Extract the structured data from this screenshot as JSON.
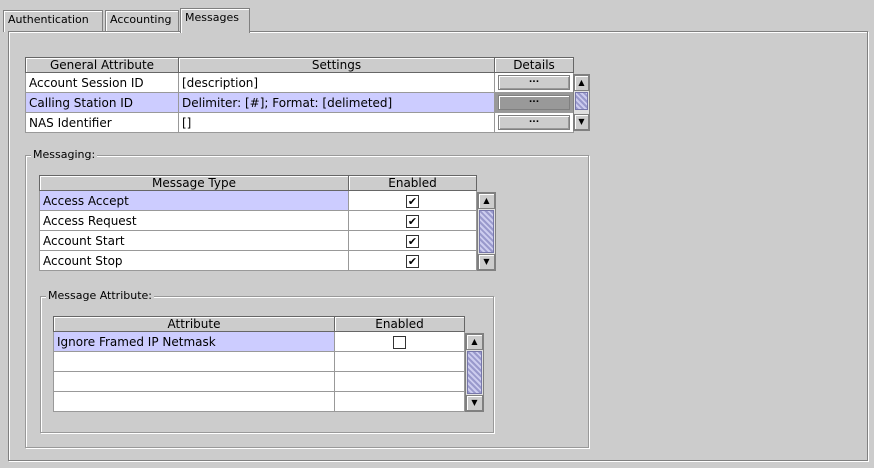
{
  "tabs": [
    "Authentication",
    "Accounting",
    "Messages"
  ],
  "attributes_table": {
    "columns": [
      "General Attribute",
      "Settings",
      "Details"
    ],
    "rows": [
      {
        "attribute": "Account Session ID",
        "settings": "[description]",
        "details": "..."
      },
      {
        "attribute": "Calling Station ID",
        "settings": "Delimiter:  [#]; Format: [delimeted]",
        "details": "..."
      },
      {
        "attribute": "NAS Identifier",
        "settings": "[]",
        "details": "..."
      }
    ]
  },
  "messaging": {
    "legend": "Messaging:",
    "columns": [
      "Message Type",
      "Enabled"
    ],
    "rows": [
      {
        "type": "Access Accept",
        "enabled": "✔"
      },
      {
        "type": "Access Request",
        "enabled": "✔"
      },
      {
        "type": "Account Start",
        "enabled": "✔"
      },
      {
        "type": "Account Stop",
        "enabled": "✔"
      }
    ]
  },
  "message_attribute": {
    "legend": "Message Attribute:",
    "columns": [
      "Attribute",
      "Enabled"
    ],
    "rows": [
      {
        "attribute": "Ignore Framed IP Netmask",
        "enabled": ""
      },
      {
        "attribute": "",
        "enabled": ""
      },
      {
        "attribute": "",
        "enabled": ""
      },
      {
        "attribute": "",
        "enabled": ""
      }
    ]
  },
  "icons": {
    "scroll_up": "▲",
    "scroll_down": "▼"
  },
  "colors": {
    "background": "#cccccc",
    "selection": "#ccccff",
    "selected_button": "#999999"
  }
}
